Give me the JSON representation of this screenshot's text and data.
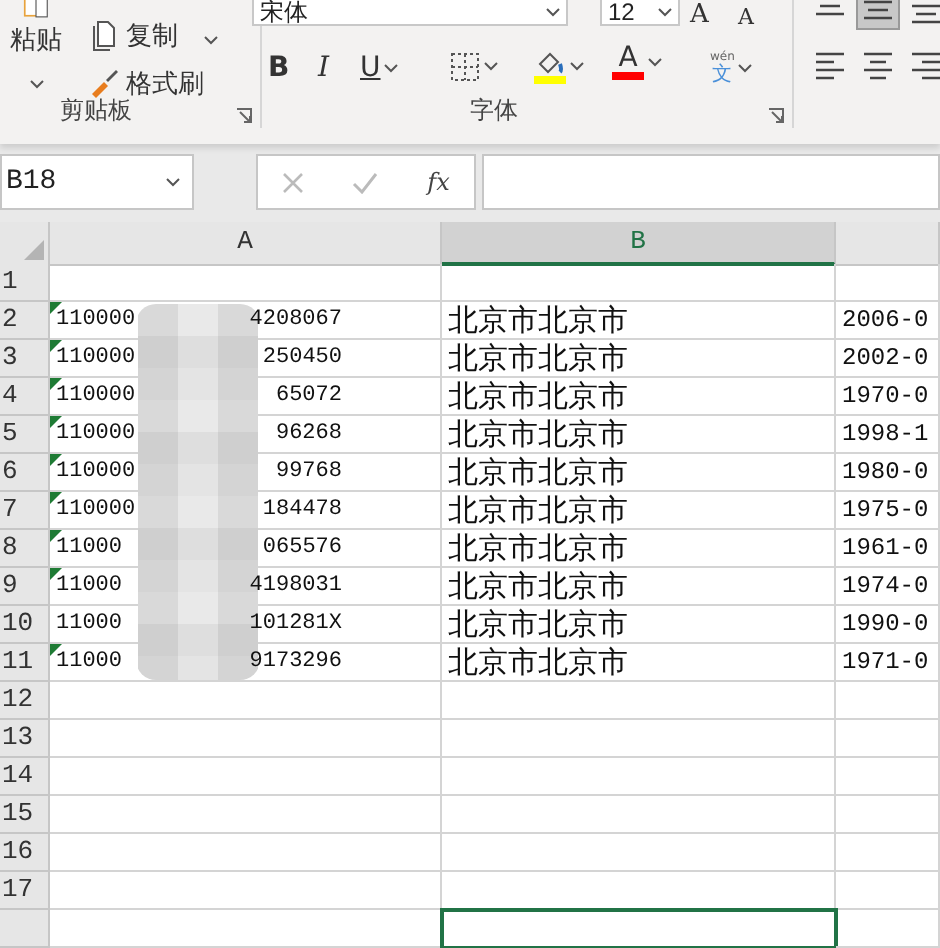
{
  "ribbon": {
    "clipboard": {
      "paste": "粘贴",
      "copy": "复制",
      "format_painter": "格式刷",
      "label": "剪贴板"
    },
    "font": {
      "font_name": "宋体",
      "font_size": "12",
      "grow": "A",
      "shrink": "A",
      "bold": "B",
      "italic": "I",
      "underline": "U",
      "color_buttons": [
        {
          "kind": "fill",
          "color": "#ffff00"
        },
        {
          "kind": "text",
          "label": "A",
          "color": "#ff0000"
        }
      ],
      "phonetic": {
        "pinyin": "wén",
        "character": "文"
      },
      "label": "字体"
    },
    "alignment": [
      {
        "kind": "top",
        "selected": false
      },
      {
        "kind": "middle",
        "selected": true
      },
      {
        "kind": "bottom",
        "selected": false
      },
      {
        "kind": "left",
        "selected": false
      },
      {
        "kind": "center",
        "selected": false
      },
      {
        "kind": "right",
        "selected": false
      }
    ]
  },
  "formula_bar": {
    "name_box": "B18",
    "function_label": "fx"
  },
  "sheet": {
    "columns": [
      {
        "label": "A",
        "selected": false
      },
      {
        "label": "B",
        "selected": true
      },
      {
        "selected": false
      }
    ],
    "rows": [
      {
        "number": "1",
        "cells": []
      },
      {
        "number": "2",
        "cells": [
          {
            "prefix": "110000",
            "suffix": "4208067",
            "error_flag": true
          },
          "北京市北京市",
          "2006-0"
        ]
      },
      {
        "number": "3",
        "cells": [
          {
            "prefix": "110000",
            "suffix": "250450",
            "error_flag": true
          },
          "北京市北京市",
          "2002-0"
        ]
      },
      {
        "number": "4",
        "cells": [
          {
            "prefix": "110000",
            "suffix": "65072",
            "error_flag": true
          },
          "北京市北京市",
          "1970-0"
        ]
      },
      {
        "number": "5",
        "cells": [
          {
            "prefix": "110000",
            "suffix": "96268",
            "error_flag": true
          },
          "北京市北京市",
          "1998-1"
        ]
      },
      {
        "number": "6",
        "cells": [
          {
            "prefix": "110000",
            "suffix": "99768",
            "error_flag": true
          },
          "北京市北京市",
          "1980-0"
        ]
      },
      {
        "number": "7",
        "cells": [
          {
            "prefix": "110000",
            "suffix": "184478",
            "error_flag": true
          },
          "北京市北京市",
          "1975-0"
        ]
      },
      {
        "number": "8",
        "cells": [
          {
            "prefix": "11000",
            "suffix": "065576",
            "error_flag": true
          },
          "北京市北京市",
          "1961-0"
        ]
      },
      {
        "number": "9",
        "cells": [
          {
            "prefix": "11000",
            "suffix": "4198031",
            "error_flag": true
          },
          "北京市北京市",
          "1974-0"
        ]
      },
      {
        "number": "10",
        "cells": [
          {
            "prefix": "11000",
            "suffix": "101281X",
            "error_flag": false
          },
          "北京市北京市",
          "1990-0"
        ]
      },
      {
        "number": "11",
        "cells": [
          {
            "prefix": "11000",
            "suffix": "9173296",
            "error_flag": true
          },
          "北京市北京市",
          "1971-0"
        ]
      },
      {
        "number": "12",
        "cells": []
      },
      {
        "number": "13",
        "cells": []
      },
      {
        "number": "14",
        "cells": []
      },
      {
        "number": "15",
        "cells": []
      },
      {
        "number": "16",
        "cells": []
      },
      {
        "number": "17",
        "cells": []
      }
    ],
    "partial_row": {
      "cells": [
        {
          "selected": false
        },
        {
          "selected": true
        },
        {
          "selected": false
        }
      ]
    }
  }
}
